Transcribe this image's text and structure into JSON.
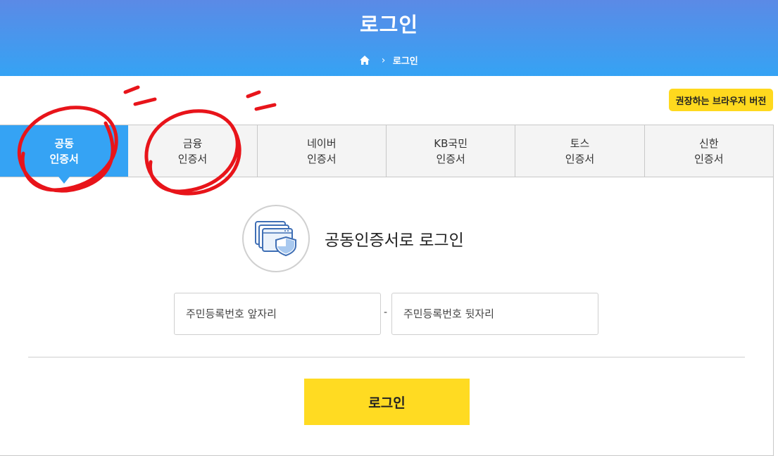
{
  "header": {
    "title": "로그인",
    "breadcrumb_current": "로그인",
    "home_icon": "home-icon"
  },
  "browser_button": {
    "label": "권장하는 브라우저 버전"
  },
  "tabs": [
    {
      "line1": "공동",
      "line2": "인증서",
      "active": true
    },
    {
      "line1": "금융",
      "line2": "인증서",
      "active": false
    },
    {
      "line1": "네이버",
      "line2": "인증서",
      "active": false
    },
    {
      "line1": "KB국민",
      "line2": "인증서",
      "active": false
    },
    {
      "line1": "토스",
      "line2": "인증서",
      "active": false
    },
    {
      "line1": "신한",
      "line2": "인증서",
      "active": false
    }
  ],
  "cert": {
    "icon": "certificate-shield-icon",
    "title": "공동인증서로 로그인"
  },
  "form": {
    "front_placeholder": "주민등록번호 앞자리",
    "separator": "-",
    "back_placeholder": "주민등록번호 뒷자리"
  },
  "login_button": {
    "label": "로그인"
  },
  "colors": {
    "header_top": "#5b8ae6",
    "header_bottom": "#35a3f4",
    "active_tab": "#35a3f4",
    "accent_yellow": "#ffdb22",
    "annotation_red": "#e8141a"
  }
}
